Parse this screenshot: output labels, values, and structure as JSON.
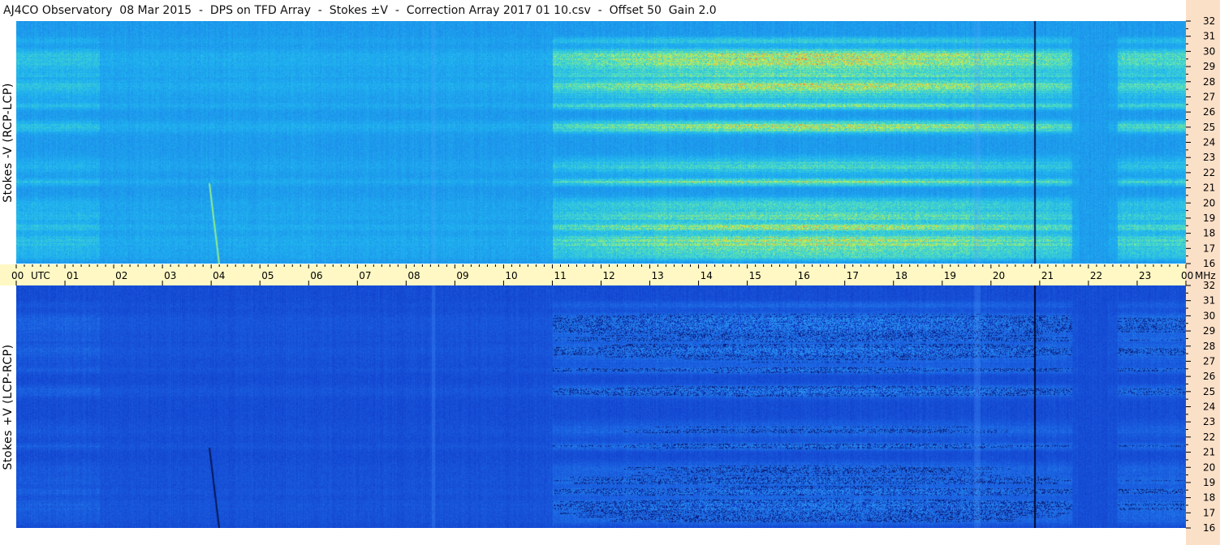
{
  "title": "AJ4CO Observatory  08 Mar 2015  -  DPS on TFD Array  -  Stokes ±V  -  Correction Array 2017 01 10.csv  -  Offset 50  Gain 2.0",
  "chart_data": [
    {
      "type": "heatmap",
      "panel": "top",
      "ylabel": "Stokes -V (RCP-LCP)",
      "x_unit": "UTC",
      "y_unit": "MHz",
      "x_range_hours": [
        0,
        24
      ],
      "y_range_mhz": [
        16,
        32
      ],
      "x_ticks": [
        "00",
        "01",
        "02",
        "03",
        "04",
        "05",
        "06",
        "07",
        "08",
        "09",
        "10",
        "11",
        "12",
        "13",
        "14",
        "15",
        "16",
        "17",
        "18",
        "19",
        "20",
        "21",
        "22",
        "23",
        "00"
      ],
      "y_ticks": [
        "16",
        "17",
        "18",
        "19",
        "20",
        "21",
        "22",
        "23",
        "24",
        "25",
        "26",
        "27",
        "28",
        "29",
        "30",
        "31",
        "32"
      ],
      "palette": [
        "#0a1a6e",
        "#1040d8",
        "#1a7fe8",
        "#20b4f0",
        "#50e0c0",
        "#d8f040",
        "#ff6040"
      ]
    },
    {
      "type": "heatmap",
      "panel": "bottom",
      "ylabel": "Stokes +V (LCP-RCP)",
      "x_unit": "UTC",
      "y_unit": "MHz",
      "x_range_hours": [
        0,
        24
      ],
      "y_range_mhz": [
        16,
        32
      ],
      "x_ticks": [
        "00",
        "01",
        "02",
        "03",
        "04",
        "05",
        "06",
        "07",
        "08",
        "09",
        "10",
        "11",
        "12",
        "13",
        "14",
        "15",
        "16",
        "17",
        "18",
        "19",
        "20",
        "21",
        "22",
        "23",
        "00"
      ],
      "y_ticks": [
        "16",
        "17",
        "18",
        "19",
        "20",
        "21",
        "22",
        "23",
        "24",
        "25",
        "26",
        "27",
        "28",
        "29",
        "30",
        "31",
        "32"
      ],
      "palette": [
        "#050a40",
        "#0a1a6e",
        "#1038c8",
        "#1a60e0",
        "#2890f0",
        "#40c0f0",
        "#f0f040"
      ]
    }
  ],
  "axis": {
    "utc_label": "UTC",
    "mhz_label": "MHz"
  }
}
